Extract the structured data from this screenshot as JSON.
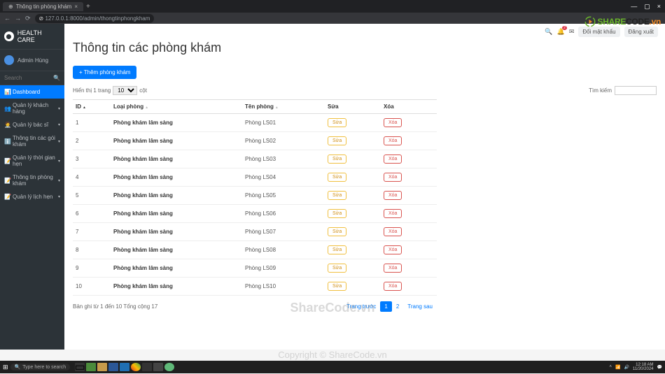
{
  "browser": {
    "tab_title": "Thông tin phòng khám",
    "url": "127.0.0.1:8000/admin/thongtinphongkham"
  },
  "brand": "HEALTH CARE",
  "user": "Admin Hùng",
  "search_placeholder": "Search",
  "nav": [
    {
      "label": "Dashboard",
      "icon": "📊",
      "active": true,
      "expand": false
    },
    {
      "label": "Quản lý khách hàng",
      "icon": "👥",
      "active": false,
      "expand": true
    },
    {
      "label": "Quản lý bác sĩ",
      "icon": "🧑‍⚕️",
      "active": false,
      "expand": true
    },
    {
      "label": "Thông tin các gói khám",
      "icon": "ℹ️",
      "active": false,
      "expand": true
    },
    {
      "label": "Quản lý thời gian hẹn",
      "icon": "📝",
      "active": false,
      "expand": true
    },
    {
      "label": "Thông tin phòng khám",
      "icon": "📝",
      "active": false,
      "expand": true
    },
    {
      "label": "Quản lý lịch hẹn",
      "icon": "📝",
      "active": false,
      "expand": true
    }
  ],
  "topbar": {
    "change_pw": "Đổi mật khẩu",
    "logout": "Đăng xuất"
  },
  "page": {
    "title": "Thông tin các phòng khám",
    "add_btn": "+ Thêm phòng khám",
    "show_prefix": "Hiển thị 1 trang",
    "show_value": "10",
    "show_suffix": "cột",
    "search_label": "Tìm kiếm",
    "columns": [
      "ID",
      "Loại phòng",
      "Tên phòng",
      "Sửa",
      "Xóa"
    ],
    "rows": [
      {
        "id": "1",
        "loai": "Phòng khám lâm sàng",
        "ten": "Phòng LS01"
      },
      {
        "id": "2",
        "loai": "Phòng khám lâm sàng",
        "ten": "Phòng LS02"
      },
      {
        "id": "3",
        "loai": "Phòng khám lâm sàng",
        "ten": "Phòng LS03"
      },
      {
        "id": "4",
        "loai": "Phòng khám lâm sàng",
        "ten": "Phòng LS04"
      },
      {
        "id": "5",
        "loai": "Phòng khám lâm sàng",
        "ten": "Phòng LS05"
      },
      {
        "id": "6",
        "loai": "Phòng khám lâm sàng",
        "ten": "Phòng LS06"
      },
      {
        "id": "7",
        "loai": "Phòng khám lâm sàng",
        "ten": "Phòng LS07"
      },
      {
        "id": "8",
        "loai": "Phòng khám lâm sàng",
        "ten": "Phòng LS08"
      },
      {
        "id": "9",
        "loai": "Phòng khám lâm sàng",
        "ten": "Phòng LS09"
      },
      {
        "id": "10",
        "loai": "Phòng khám lâm sàng",
        "ten": "Phòng LS10"
      }
    ],
    "edit_label": "Sửa",
    "del_label": "Xóa",
    "info": "Bản ghi từ 1 đến 10 Tổng cộng 17",
    "prev": "Trang trước",
    "page1": "1",
    "page2": "2",
    "next": "Trang sau"
  },
  "watermark": {
    "share": "SHARE",
    "code": "CODE",
    "vn": ".vn",
    "big": "ShareCode.vn",
    "mid": "Copyright © ShareCode.vn"
  },
  "taskbar": {
    "search": "Type here to search",
    "time": "12:18 AM",
    "date": "11/20/2024"
  }
}
